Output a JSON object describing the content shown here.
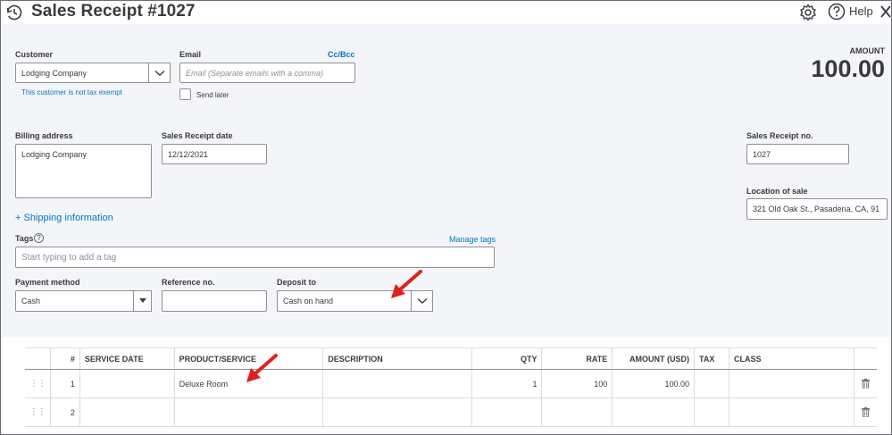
{
  "header": {
    "title": "Sales Receipt #1027",
    "help_label": "Help"
  },
  "customer": {
    "label": "Customer",
    "value": "Lodging Company",
    "tax_note": "This customer is not tax exempt"
  },
  "email": {
    "label": "Email",
    "cc_bcc": "Cc/Bcc",
    "placeholder": "Email (Separate emails with a comma)",
    "send_later": "Send later"
  },
  "amount": {
    "label": "AMOUNT",
    "value": "100.00"
  },
  "billing_address": {
    "label": "Billing address",
    "value": "Lodging Company"
  },
  "receipt_date": {
    "label": "Sales Receipt date",
    "value": "12/12/2021"
  },
  "receipt_no": {
    "label": "Sales Receipt no.",
    "value": "1027"
  },
  "location": {
    "label": "Location of sale",
    "value": "321 Old Oak St., Pasadena, CA, 91"
  },
  "shipping": {
    "label": "+ Shipping information"
  },
  "tags": {
    "label": "Tags",
    "manage": "Manage tags",
    "placeholder": "Start typing to add a tag"
  },
  "payment_method": {
    "label": "Payment method",
    "value": "Cash"
  },
  "reference": {
    "label": "Reference no.",
    "value": ""
  },
  "deposit_to": {
    "label": "Deposit to",
    "value": "Cash on hand"
  },
  "table": {
    "headers": {
      "num": "#",
      "service_date": "SERVICE DATE",
      "product": "PRODUCT/SERVICE",
      "description": "DESCRIPTION",
      "qty": "QTY",
      "rate": "RATE",
      "amount": "AMOUNT (USD)",
      "tax": "TAX",
      "class": "CLASS"
    },
    "rows": [
      {
        "num": "1",
        "service_date": "",
        "product": "Deluxe Room",
        "description": "",
        "qty": "1",
        "rate": "100",
        "amount": "100.00",
        "tax": "",
        "class": ""
      },
      {
        "num": "2",
        "service_date": "",
        "product": "",
        "description": "",
        "qty": "",
        "rate": "",
        "amount": "",
        "tax": "",
        "class": ""
      }
    ]
  },
  "colors": {
    "link": "#0077c5",
    "annotation_arrow": "#e0201b",
    "form_bg": "#f4f5f8"
  },
  "icons": [
    "history-icon",
    "gear-icon",
    "help-icon",
    "close-icon",
    "chevron-down-icon",
    "info-icon",
    "drag-handle-icon",
    "trash-icon"
  ]
}
